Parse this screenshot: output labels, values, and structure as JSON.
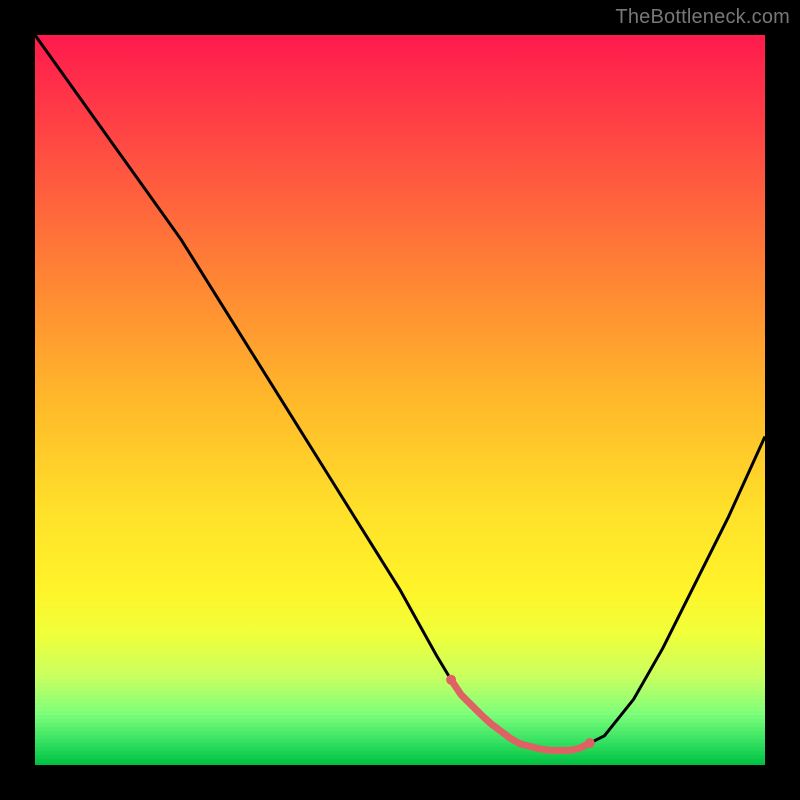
{
  "watermark": "TheBottleneck.com",
  "colors": {
    "frame": "#000000",
    "curve_black": "#000000",
    "highlight_red": "#de6264",
    "gradient_top": "#ff1a4d",
    "gradient_bottom": "#00c040"
  },
  "chart_data": {
    "type": "line",
    "title": "",
    "xlabel": "",
    "ylabel": "",
    "xlim": [
      0,
      100
    ],
    "ylim": [
      0,
      100
    ],
    "note": "A V-shaped bottleneck curve. x ≈ relative component index (0–100). y ≈ bottleneck severity (0 = none, 100 = max). Values are estimated from the plot pixels; no numeric axes are shown in the image.",
    "x": [
      0,
      5,
      10,
      15,
      20,
      25,
      30,
      35,
      40,
      45,
      50,
      55,
      58,
      62,
      66,
      70,
      74,
      78,
      82,
      86,
      90,
      95,
      100
    ],
    "values": [
      100,
      93,
      86,
      79,
      72,
      64,
      56,
      48,
      40,
      32,
      24,
      15,
      10,
      6,
      3,
      2,
      2,
      4,
      9,
      16,
      24,
      34,
      45
    ],
    "highlight_region": {
      "x_start": 57,
      "x_end": 76,
      "y_level": 6
    }
  }
}
